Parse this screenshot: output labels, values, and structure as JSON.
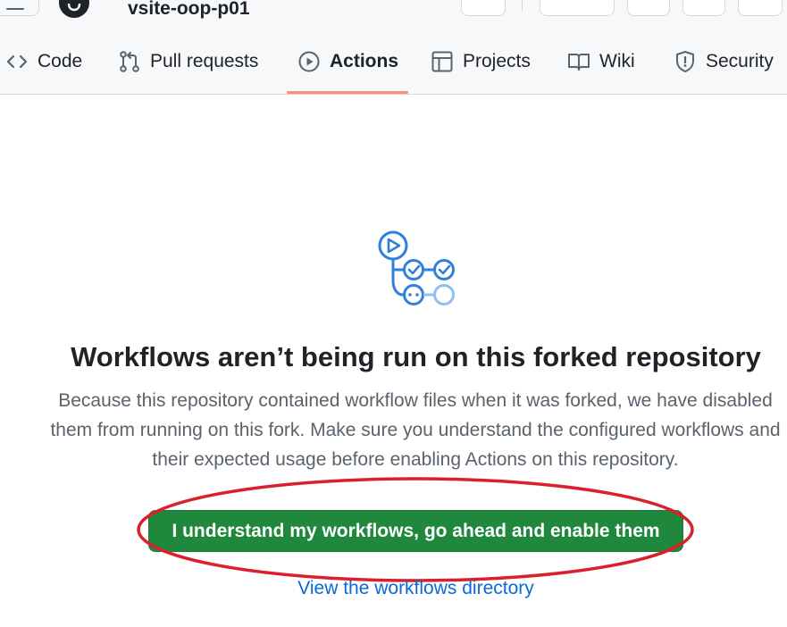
{
  "header": {
    "repo_name": "vsite-oop-p01"
  },
  "nav": {
    "items": [
      {
        "label": "Code",
        "icon": "code-icon"
      },
      {
        "label": "Pull requests",
        "icon": "git-pull-request-icon"
      },
      {
        "label": "Actions",
        "icon": "play-circle-icon",
        "active": true
      },
      {
        "label": "Projects",
        "icon": "table-icon"
      },
      {
        "label": "Wiki",
        "icon": "book-icon"
      },
      {
        "label": "Security",
        "icon": "shield-icon"
      }
    ]
  },
  "main": {
    "title": "Workflows aren’t being run on this forked repository",
    "description": "Because this repository contained workflow files when it was forked, we have disabled them from running on this fork. Make sure you understand the configured workflows and their expected usage before enabling Actions on this repository.",
    "enable_button_label": "I understand my workflows, go ahead and enable them",
    "workflows_link_label": "View the workflows directory"
  },
  "colors": {
    "primary_button": "#1f883d",
    "link": "#0969da",
    "active_tab_underline": "#fd8c73",
    "illustration_blue": "#2f7fdb",
    "annotation_red": "#d9202b"
  }
}
